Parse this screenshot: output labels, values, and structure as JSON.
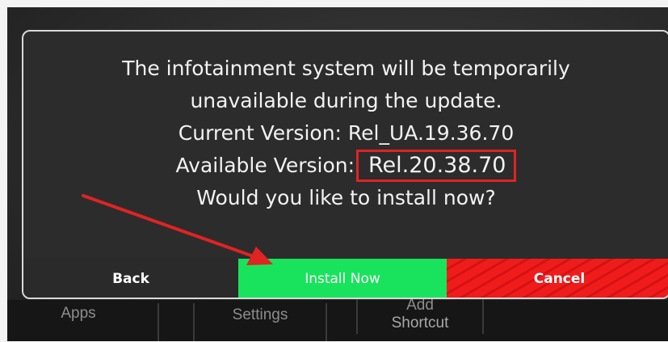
{
  "dialog": {
    "lines": [
      "The infotainment system will be temporarily",
      "unavailable during the update.",
      "Current Version: Rel_UA.19.36.70"
    ],
    "available_label": "Available Version:",
    "available_value": "Rel.20.38.70",
    "question": "Would you like to install now?"
  },
  "buttons": {
    "back": "Back",
    "install": "Install Now",
    "cancel": "Cancel"
  },
  "nav": {
    "apps": "Apps",
    "settings": "Settings",
    "add_shortcut_line1": "Add",
    "add_shortcut_line2": "Shortcut"
  },
  "colors": {
    "install_button": "#19e35c",
    "cancel_button": "#f01c1c",
    "annotation": "#e02323"
  }
}
